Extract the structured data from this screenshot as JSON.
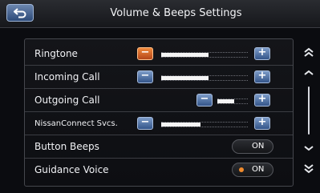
{
  "header": {
    "title": "Volume & Beeps Settings",
    "back_icon": "back-arrow-icon"
  },
  "settings": {
    "ringtone": {
      "label": "Ringtone",
      "level": 0.55,
      "minus_active": true
    },
    "incoming_call": {
      "label": "Incoming Call",
      "level": 0.55,
      "minus_active": false
    },
    "outgoing_call": {
      "label": "Outgoing Call",
      "level": 0.55,
      "minus_active": false
    },
    "nissanconnect": {
      "label": "NissanConnect Svcs.",
      "level": 0.45,
      "minus_active": false
    },
    "button_beeps": {
      "label": "Button Beeps",
      "value": "ON",
      "indicator": false
    },
    "guidance_voice": {
      "label": "Guidance Voice",
      "value": "ON",
      "indicator": true
    }
  },
  "controls": {
    "minus_glyph": "−",
    "plus_glyph": "+"
  },
  "scroll": {
    "icons": [
      "double-chevron-up-icon",
      "chevron-up-icon",
      "chevron-down-icon",
      "double-chevron-down-icon"
    ]
  },
  "colors": {
    "accent_orange": "#f08a3c",
    "button_blue": "#34558a",
    "indicator_orange": "#f08a2c"
  }
}
